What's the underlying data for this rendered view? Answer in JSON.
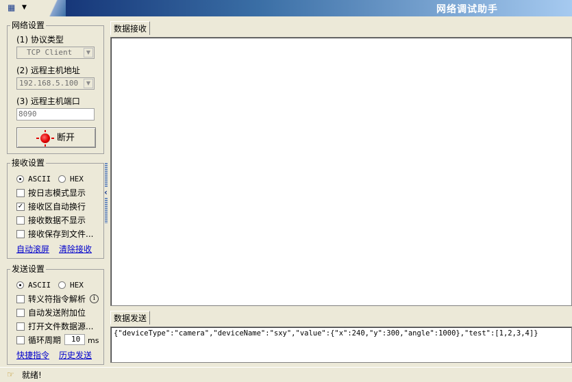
{
  "window": {
    "title": "网络调试助手",
    "system_icon": "network-icon"
  },
  "network_settings": {
    "legend": "网络设置",
    "protocol_label": "(1) 协议类型",
    "protocol_value": "TCP Client",
    "host_label": "(2) 远程主机地址",
    "host_value": "192.168.5.100",
    "port_label": "(3) 远程主机端口",
    "port_value": "8090",
    "disconnect_label": "断开",
    "led_color": "#e00000"
  },
  "receive_settings": {
    "legend": "接收设置",
    "ascii_label": "ASCII",
    "hex_label": "HEX",
    "mode_selected": "ASCII",
    "options": [
      {
        "label": "按日志模式显示",
        "checked": false
      },
      {
        "label": "接收区自动换行",
        "checked": true
      },
      {
        "label": "接收数据不显示",
        "checked": false
      },
      {
        "label": "接收保存到文件...",
        "checked": false
      }
    ],
    "link_autoscroll": "自动滚屏",
    "link_clear": "清除接收"
  },
  "send_settings": {
    "legend": "发送设置",
    "ascii_label": "ASCII",
    "hex_label": "HEX",
    "mode_selected": "ASCII",
    "options": [
      {
        "label": "转义符指令解析",
        "checked": false
      },
      {
        "label": "自动发送附加位",
        "checked": false
      },
      {
        "label": "打开文件数据源...",
        "checked": false
      },
      {
        "label": "循环周期",
        "checked": false
      }
    ],
    "period_value": "10",
    "period_unit": "ms",
    "link_shortcut": "快捷指令",
    "link_history": "历史发送"
  },
  "receive_area": {
    "tab_label": "数据接收",
    "content": ""
  },
  "send_area": {
    "tab_label": "数据发送",
    "content": "{\"deviceType\":\"camera\",\"deviceName\":\"sxy\",\"value\":{\"x\":240,\"y\":300,\"angle\":1000},\"test\":[1,2,3,4]}"
  },
  "status_bar": {
    "text": "就绪!",
    "icon": "pointing-hand-icon"
  }
}
